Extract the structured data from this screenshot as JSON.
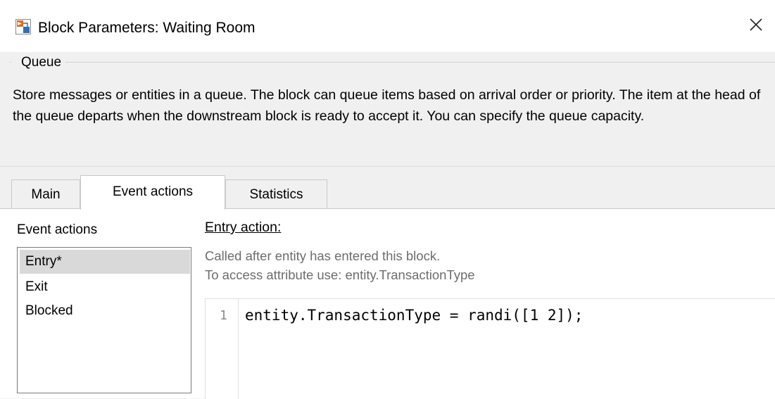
{
  "window": {
    "title": "Block Parameters: Waiting Room",
    "app_icon": "simulink-block-icon",
    "close_icon": "close-icon"
  },
  "group": {
    "title": "Queue",
    "description": "Store messages or entities in a queue. The block can queue items based on arrival order or priority. The item at the head of the queue departs when the downstream block is ready to accept it. You can specify the queue capacity."
  },
  "tabs": [
    {
      "label": "Main",
      "active": false
    },
    {
      "label": "Event actions",
      "active": true
    },
    {
      "label": "Statistics",
      "active": false
    }
  ],
  "event_actions": {
    "label": "Event actions",
    "items": [
      {
        "label": "Entry*",
        "selected": true
      },
      {
        "label": "Exit",
        "selected": false
      },
      {
        "label": "Blocked",
        "selected": false
      }
    ]
  },
  "entry_action": {
    "heading": "Entry action:",
    "hint_line1": "Called after entity has entered this block.",
    "hint_line2": "To access attribute use: entity.TransactionType",
    "code": [
      {
        "line": "1",
        "text": "entity.TransactionType = randi([1 2]);"
      }
    ]
  }
}
